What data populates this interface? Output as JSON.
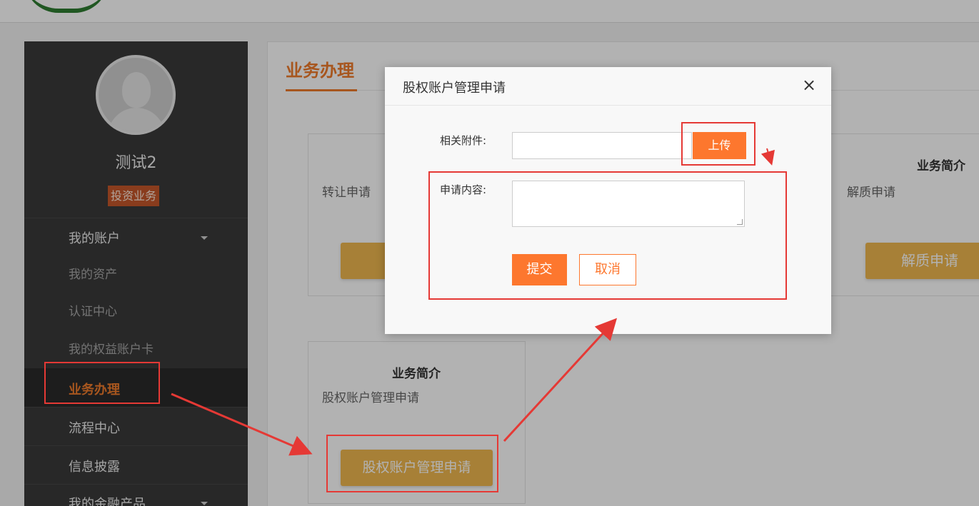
{
  "sidebar": {
    "username": "测试2",
    "role": "投资业务",
    "menu": {
      "my_account": "我的账户",
      "my_assets": "我的资产",
      "certification": "认证中心",
      "equity_card": "我的权益账户卡",
      "business": "业务办理",
      "process_center": "流程中心",
      "disclosure": "信息披露",
      "financial_products": "我的金融产品"
    }
  },
  "main": {
    "title": "业务办理",
    "cards": [
      {
        "heading": "",
        "desc": "转让申请",
        "button": ""
      },
      {
        "heading": "业务简介",
        "desc": "解质申请",
        "button": "解质申请"
      },
      {
        "heading": "业务简介",
        "desc": "股权账户管理申请",
        "button": "股权账户管理申请"
      }
    ]
  },
  "modal": {
    "title": "股权账户管理申请",
    "close": "×",
    "attachment_label": "相关附件:",
    "upload": "上传",
    "content_label": "申请内容:",
    "submit": "提交",
    "cancel": "取消"
  },
  "colors": {
    "accent": "#f07c2c",
    "button_orange": "#fd772e",
    "card_button": "#efb84f",
    "sidebar_bg": "#3a3a3a",
    "annotation": "#e53935"
  }
}
